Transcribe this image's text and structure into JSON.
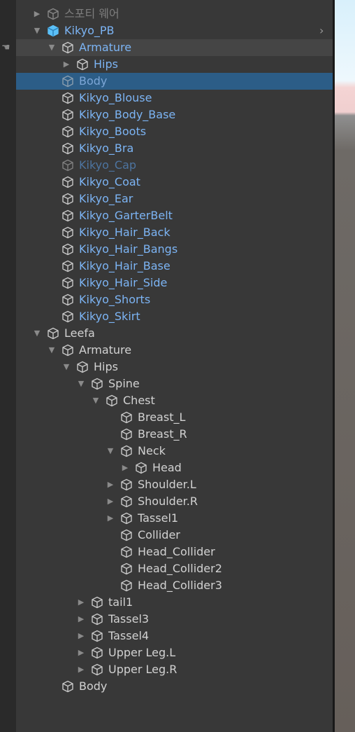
{
  "colors": {
    "background": "#383838",
    "gutter": "#2a2a2a",
    "selected_row": "#2c5d87",
    "hover_row": "#454545",
    "prefab_text": "#7cb4f4",
    "normal_text": "#d2d2d2",
    "prefab_root_icon": "#5bc0f8"
  },
  "rows": [
    {
      "label": "스포티 웨어",
      "depth": 0,
      "arrow": "right",
      "style": "inactive"
    },
    {
      "label": "Kikyo_PB",
      "depth": 0,
      "arrow": "down",
      "style": "prefab",
      "icon": "prefab-cube-icon",
      "chevron": true
    },
    {
      "label": "Armature",
      "depth": 1,
      "arrow": "down",
      "style": "prefab",
      "state": "hover",
      "hand": true
    },
    {
      "label": "Hips",
      "depth": 2,
      "arrow": "right",
      "style": "prefab"
    },
    {
      "label": "Body",
      "depth": 1,
      "arrow": "none",
      "style": "prefab",
      "state": "selected"
    },
    {
      "label": "Kikyo_Blouse",
      "depth": 1,
      "arrow": "none",
      "style": "prefab"
    },
    {
      "label": "Kikyo_Body_Base",
      "depth": 1,
      "arrow": "none",
      "style": "prefab"
    },
    {
      "label": "Kikyo_Boots",
      "depth": 1,
      "arrow": "none",
      "style": "prefab"
    },
    {
      "label": "Kikyo_Bra",
      "depth": 1,
      "arrow": "none",
      "style": "prefab"
    },
    {
      "label": "Kikyo_Cap",
      "depth": 1,
      "arrow": "none",
      "style": "prefab-disabled"
    },
    {
      "label": "Kikyo_Coat",
      "depth": 1,
      "arrow": "none",
      "style": "prefab"
    },
    {
      "label": "Kikyo_Ear",
      "depth": 1,
      "arrow": "none",
      "style": "prefab"
    },
    {
      "label": "Kikyo_GarterBelt",
      "depth": 1,
      "arrow": "none",
      "style": "prefab"
    },
    {
      "label": "Kikyo_Hair_Back",
      "depth": 1,
      "arrow": "none",
      "style": "prefab"
    },
    {
      "label": "Kikyo_Hair_Bangs",
      "depth": 1,
      "arrow": "none",
      "style": "prefab"
    },
    {
      "label": "Kikyo_Hair_Base",
      "depth": 1,
      "arrow": "none",
      "style": "prefab"
    },
    {
      "label": "Kikyo_Hair_Side",
      "depth": 1,
      "arrow": "none",
      "style": "prefab"
    },
    {
      "label": "Kikyo_Shorts",
      "depth": 1,
      "arrow": "none",
      "style": "prefab"
    },
    {
      "label": "Kikyo_Skirt",
      "depth": 1,
      "arrow": "none",
      "style": "prefab"
    },
    {
      "label": "Leefa",
      "depth": 0,
      "arrow": "down",
      "style": "normal"
    },
    {
      "label": "Armature",
      "depth": 1,
      "arrow": "down",
      "style": "normal"
    },
    {
      "label": "Hips",
      "depth": 2,
      "arrow": "down",
      "style": "normal"
    },
    {
      "label": "Spine",
      "depth": 3,
      "arrow": "down",
      "style": "normal"
    },
    {
      "label": "Chest",
      "depth": 4,
      "arrow": "down",
      "style": "normal"
    },
    {
      "label": "Breast_L",
      "depth": 5,
      "arrow": "none",
      "style": "normal"
    },
    {
      "label": "Breast_R",
      "depth": 5,
      "arrow": "none",
      "style": "normal"
    },
    {
      "label": "Neck",
      "depth": 5,
      "arrow": "down",
      "style": "normal"
    },
    {
      "label": "Head",
      "depth": 6,
      "arrow": "right",
      "style": "normal"
    },
    {
      "label": "Shoulder.L",
      "depth": 5,
      "arrow": "right",
      "style": "normal"
    },
    {
      "label": "Shoulder.R",
      "depth": 5,
      "arrow": "right",
      "style": "normal"
    },
    {
      "label": "Tassel1",
      "depth": 5,
      "arrow": "right",
      "style": "normal"
    },
    {
      "label": "Collider",
      "depth": 5,
      "arrow": "none",
      "style": "normal"
    },
    {
      "label": "Head_Collider",
      "depth": 5,
      "arrow": "none",
      "style": "normal"
    },
    {
      "label": "Head_Collider2",
      "depth": 5,
      "arrow": "none",
      "style": "normal"
    },
    {
      "label": "Head_Collider3",
      "depth": 5,
      "arrow": "none",
      "style": "normal"
    },
    {
      "label": "tail1",
      "depth": 3,
      "arrow": "right",
      "style": "normal"
    },
    {
      "label": "Tassel3",
      "depth": 3,
      "arrow": "right",
      "style": "normal"
    },
    {
      "label": "Tassel4",
      "depth": 3,
      "arrow": "right",
      "style": "normal"
    },
    {
      "label": "Upper Leg.L",
      "depth": 3,
      "arrow": "right",
      "style": "normal"
    },
    {
      "label": "Upper Leg.R",
      "depth": 3,
      "arrow": "right",
      "style": "normal"
    },
    {
      "label": "Body",
      "depth": 1,
      "arrow": "none",
      "style": "normal"
    }
  ]
}
